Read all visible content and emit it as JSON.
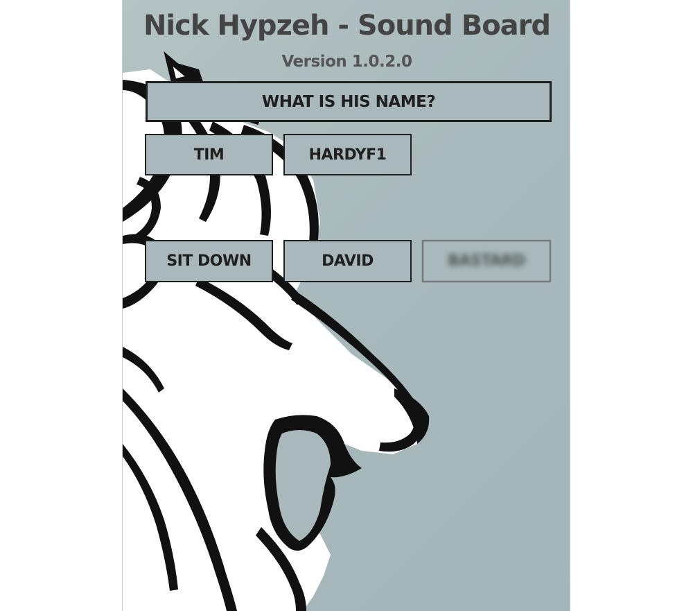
{
  "app": {
    "title": "Nick Hypzeh - Sound Board",
    "version": "Version 1.0.2.0"
  },
  "buttons": {
    "what_is_his_name": "WHAT IS HIS NAME?",
    "tim": "TIM",
    "hardyf1": "HARDYF1",
    "sit_down": "SIT DOWN",
    "david": "DAVID",
    "obscured": "BASTARD"
  },
  "colors": {
    "background": "#a9b8ba",
    "button_border": "#1f1f1f",
    "title_text": "#444444"
  }
}
